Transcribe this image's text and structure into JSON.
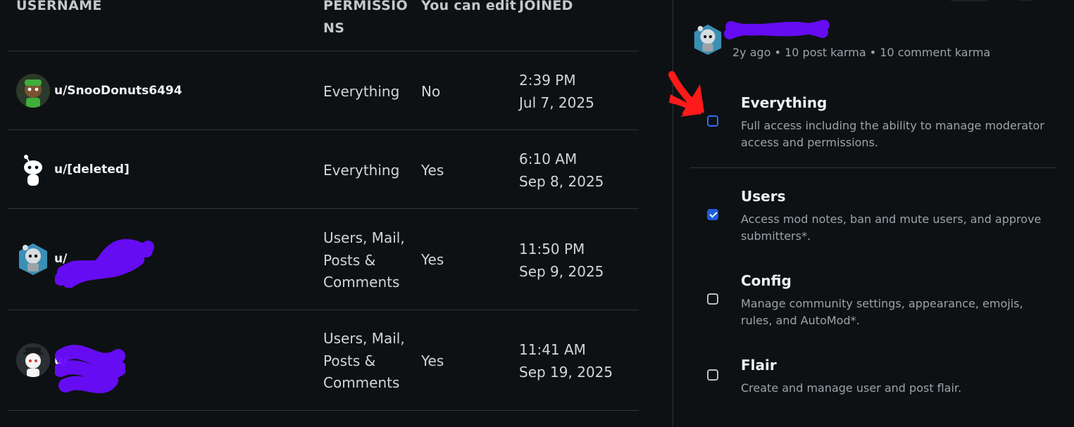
{
  "table": {
    "headers": {
      "username": "USERNAME",
      "permissions_1": "PERMISSIO",
      "permissions_2": "NS",
      "can_edit": "You can edit",
      "joined": "JOINED"
    },
    "rows": [
      {
        "username": "u/SnooDonuts6494",
        "perm_lines": [
          "Everything"
        ],
        "can_edit": "No",
        "time": "2:39 PM",
        "date": "Jul 7, 2025"
      },
      {
        "username": "u/[deleted]",
        "perm_lines": [
          "Everything"
        ],
        "can_edit": "Yes",
        "time": "6:10 AM",
        "date": "Sep 8, 2025"
      },
      {
        "username": "u/",
        "perm_lines": [
          "Users, Mail,",
          "Posts &",
          "Comments"
        ],
        "can_edit": "Yes",
        "time": "11:50 PM",
        "date": "Sep 9, 2025"
      },
      {
        "username": "u/",
        "perm_lines": [
          "Users, Mail,",
          "Posts &",
          "Comments"
        ],
        "can_edit": "Yes",
        "time": "11:41 AM",
        "date": "Sep 19, 2025"
      }
    ]
  },
  "side": {
    "meta": "2y ago • 10 post karma • 10 comment karma",
    "permissions": [
      {
        "title": "Everything",
        "desc": "Full access including the ability to manage moderator access and permissions.",
        "checked": false
      },
      {
        "title": "Users",
        "desc": "Access mod notes, ban and mute users, and approve submitters*.",
        "checked": true
      },
      {
        "title": "Config",
        "desc": "Manage community settings, appearance, emojis, rules, and AutoMod*.",
        "checked": false
      },
      {
        "title": "Flair",
        "desc": "Create and manage user and post flair.",
        "checked": false
      }
    ]
  },
  "colors": {
    "background": "#0e1113",
    "checkbox_checked": "#1e5bd8",
    "redaction_scribble": "#6a0dff",
    "annotation_arrow": "#ff1a1a"
  }
}
